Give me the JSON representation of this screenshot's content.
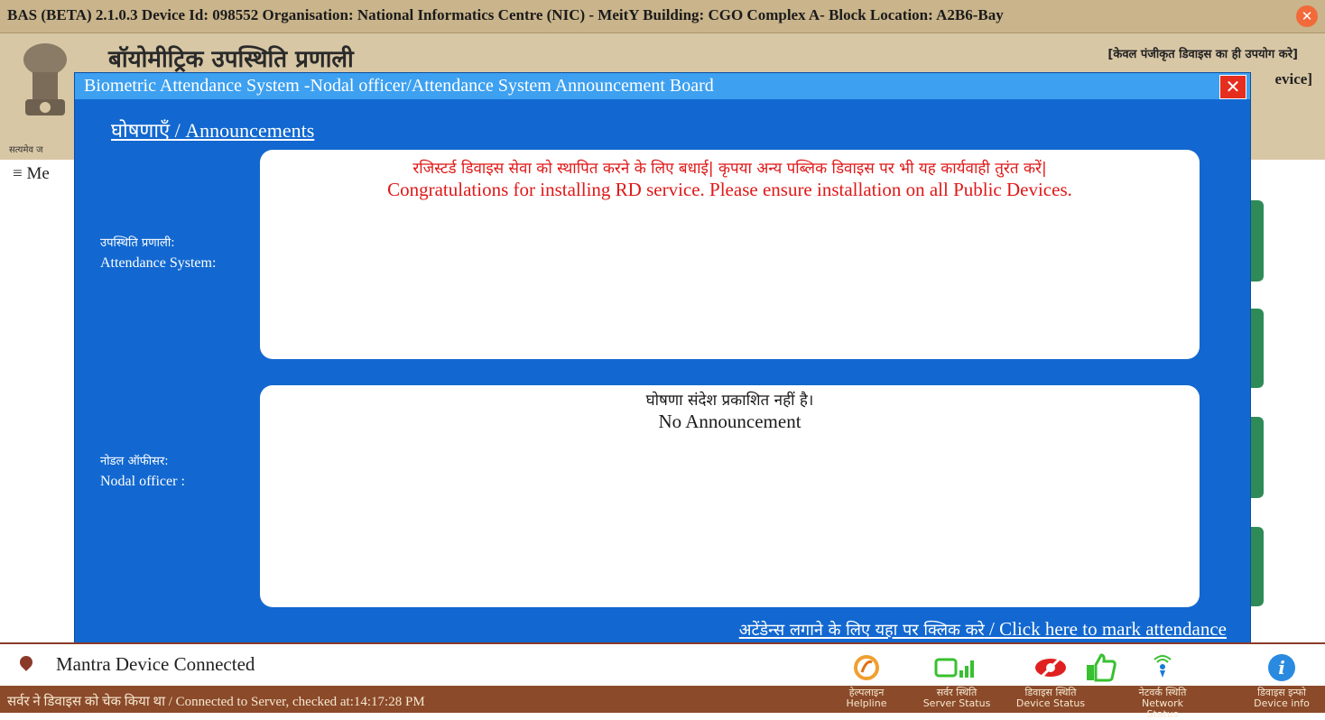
{
  "titlebar": {
    "text": "BAS (BETA) 2.1.0.3 Device Id: 098552 Organisation: National Informatics Centre (NIC) - MeitY Building: CGO Complex A- Block  Location: A2B6-Bay",
    "close_glyph": "✕"
  },
  "app": {
    "title_hindi": "बॉयोमीट्रिक उपस्थिति प्रणाली",
    "emblem_caption": "सत्यमेव ज",
    "notice_hindi": "[केवल पंजीकृत डिवाइस का ही उपयोग करे]",
    "notice_english": "evice]",
    "menu_label": "≡ Me"
  },
  "modal": {
    "title": "Biometric Attendance System  -Nodal officer/Attendance System Announcement  Board",
    "close_glyph": "✕",
    "heading": "घोषणाएँ / Announcements",
    "attendance_label_hi": "उपस्थिति प्रणाली:",
    "attendance_label_en": "Attendance System:",
    "attendance_message_hi": "रजिस्टर्ड डिवाइस सेवा को स्थापित करने के लिए बधाई| कृपया अन्य पब्लिक डिवाइस पर भी यह कार्यवाही तुरंत करें|",
    "attendance_message_en": "Congratulations for installing RD service. Please ensure installation on all Public Devices.",
    "nodal_label_hi": "नोडल ऑफीसर:",
    "nodal_label_en": "Nodal officer :",
    "nodal_message_hi": "घोषणा संदेश प्रकाशित नहीं है।",
    "nodal_message_en": "No Announcement",
    "mark_attendance_hi": "अटेंडेन्स लगाने के लिए यहा पर क्लिक करे",
    "mark_attendance_en": " / Click here to mark attendance"
  },
  "footer": {
    "device_status": "Mantra Device Connected",
    "server_check": "सर्वर ने डिवाइस को चेक किया था / Connected to Server, checked at:14:17:28 PM",
    "status_items": [
      {
        "hi": "हेल्पलाइन",
        "en": "Helpline",
        "icon": "helpline-icon"
      },
      {
        "hi": "सर्वर स्थिति",
        "en": "Server Status",
        "icon": "server-status-icon"
      },
      {
        "hi": "डिवाइस स्थिति",
        "en": "Device Status",
        "icon": "device-status-icon"
      },
      {
        "hi": "नेटवर्क स्थिति",
        "en": "Network Status",
        "icon": "network-status-icon"
      },
      {
        "hi": "डिवाइस इन्फो",
        "en": "Device info",
        "icon": "device-info-icon"
      }
    ]
  },
  "colors": {
    "modal_blue": "#1268d0",
    "modal_header": "#3da0f0",
    "message_red": "#e01818",
    "footer_brown": "#8b4a2a"
  }
}
